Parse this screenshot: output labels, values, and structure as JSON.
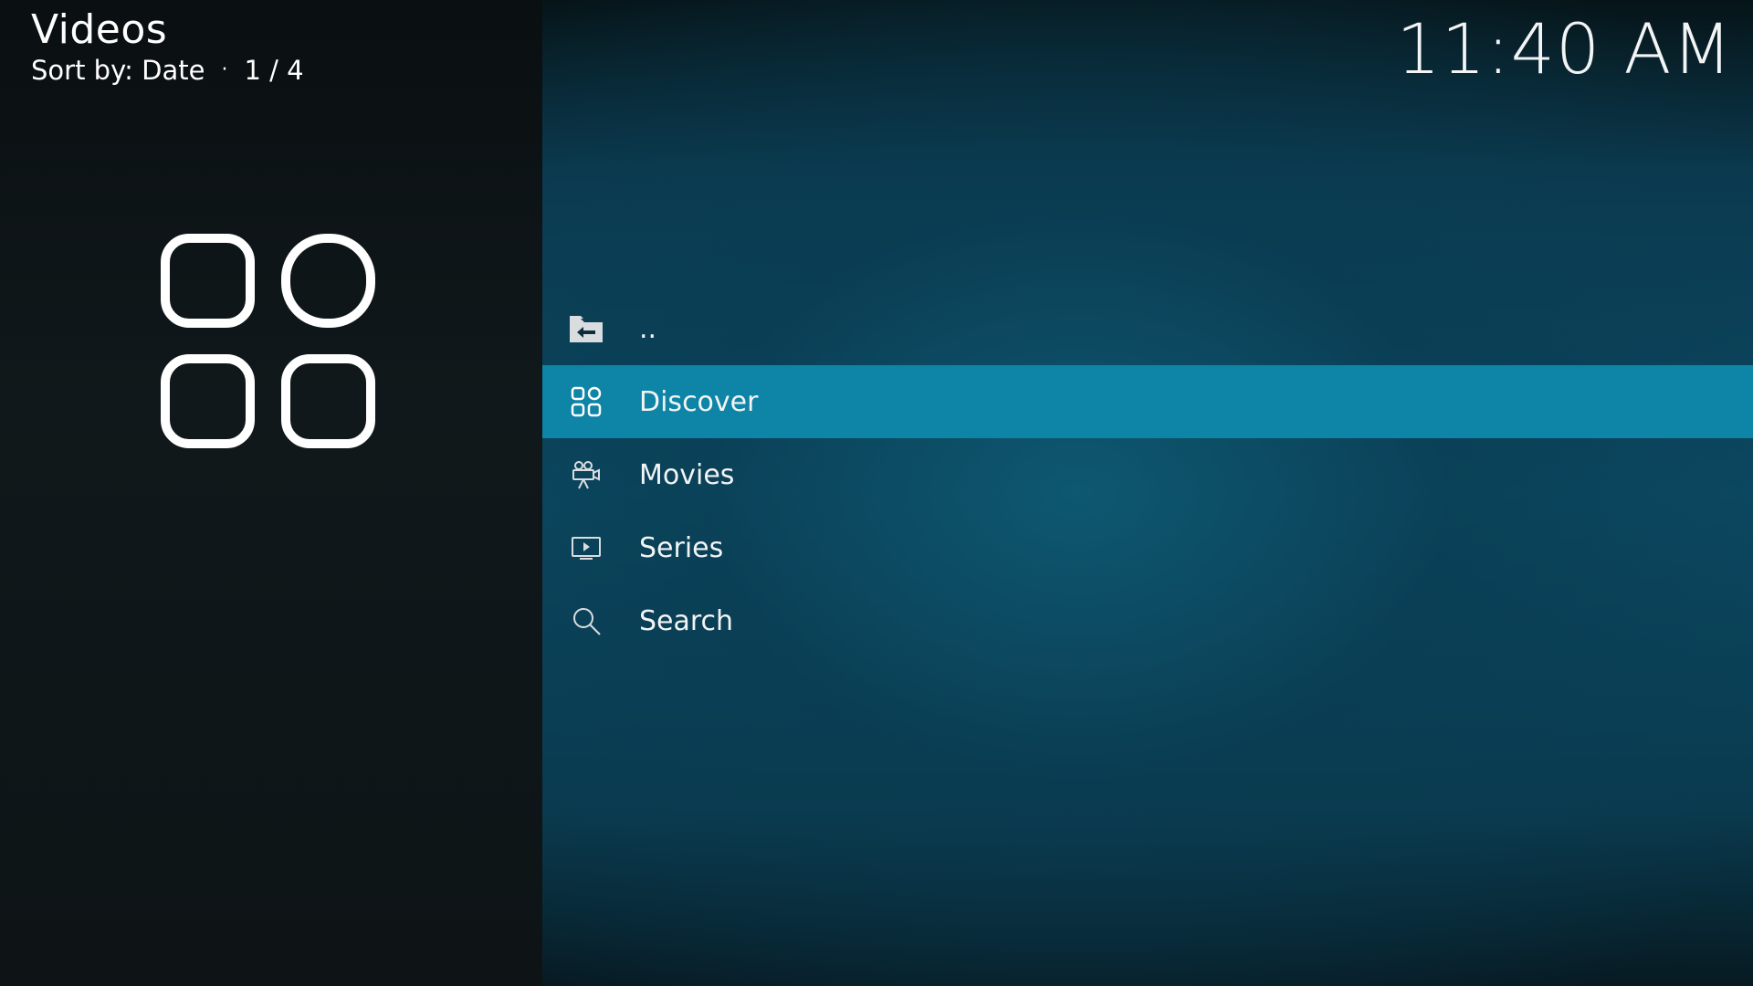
{
  "header": {
    "title": "Videos",
    "sort_label": "Sort by: Date",
    "separator": "·",
    "position": "1 / 4"
  },
  "clock": "11:40 AM",
  "colors": {
    "selected_row": "#0e84a6",
    "left_panel": "#10181b",
    "text": "#f2f4f5"
  },
  "preview_icon": "discover-grid-icon",
  "list": {
    "items": [
      {
        "label": "..",
        "icon": "parent-folder-icon",
        "selected": false
      },
      {
        "label": "Discover",
        "icon": "discover-grid-icon",
        "selected": true
      },
      {
        "label": "Movies",
        "icon": "movie-camera-icon",
        "selected": false
      },
      {
        "label": "Series",
        "icon": "tv-play-icon",
        "selected": false
      },
      {
        "label": "Search",
        "icon": "search-icon",
        "selected": false
      }
    ]
  }
}
